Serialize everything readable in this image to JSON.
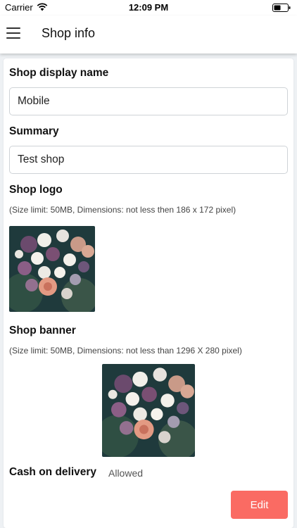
{
  "status_bar": {
    "carrier": "Carrier",
    "time": "12:09 PM"
  },
  "header": {
    "title": "Shop info"
  },
  "form": {
    "display_name_label": "Shop display name",
    "display_name_value": "Mobile",
    "summary_label": "Summary",
    "summary_value": "Test shop",
    "logo_label": "Shop logo",
    "logo_hint": "(Size limit: 50MB, Dimensions: not less then 186 x 172 pixel)",
    "banner_label": "Shop banner",
    "banner_hint": "(Size limit: 50MB, Dimensions: not less than 1296 X 280 pixel)",
    "cod_label": "Cash on delivery",
    "cod_value": "Allowed"
  },
  "actions": {
    "edit_label": "Edit"
  },
  "icons": {
    "menu": "hamburger-menu-icon",
    "wifi": "wifi-icon",
    "battery": "battery-icon"
  },
  "colors": {
    "accent": "#fa6b63",
    "background": "#eef1f4"
  }
}
